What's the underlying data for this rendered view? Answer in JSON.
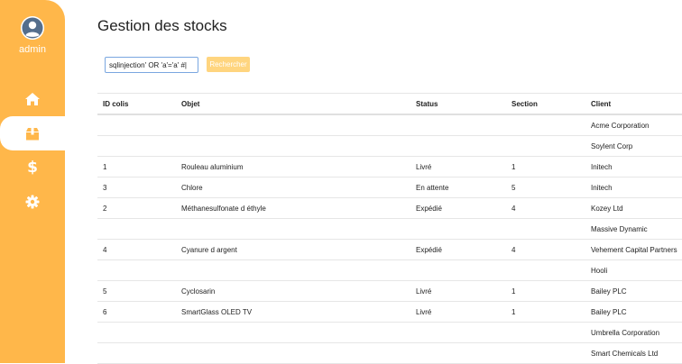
{
  "sidebar": {
    "username": "admin",
    "nav": [
      {
        "icon": "home-icon"
      },
      {
        "icon": "box-icon",
        "active": true
      },
      {
        "icon": "dollar-icon",
        "glyph": "$"
      },
      {
        "icon": "gear-icon"
      }
    ]
  },
  "page": {
    "title": "Gestion des stocks"
  },
  "search": {
    "value": "sqlinjection' OR 'a'='a' #|",
    "button_label": "Rechercher"
  },
  "table": {
    "headers": [
      "ID colis",
      "Objet",
      "Status",
      "Section",
      "Client"
    ],
    "rows": [
      [
        "",
        "",
        "",
        "",
        "Acme Corporation"
      ],
      [
        "",
        "",
        "",
        "",
        "Soylent Corp"
      ],
      [
        "1",
        "Rouleau aluminium",
        "Livré",
        "1",
        "Initech"
      ],
      [
        "3",
        "Chlore",
        "En attente",
        "5",
        "Initech"
      ],
      [
        "2",
        "Méthanesulfonate d éthyle",
        "Expédié",
        "4",
        "Kozey Ltd"
      ],
      [
        "",
        "",
        "",
        "",
        "Massive Dynamic"
      ],
      [
        "4",
        "Cyanure d argent",
        "Expédié",
        "4",
        "Vehement Capital Partners"
      ],
      [
        "",
        "",
        "",
        "",
        "Hooli"
      ],
      [
        "5",
        "Cyclosarin",
        "Livré",
        "1",
        "Bailey PLC"
      ],
      [
        "6",
        "SmartGlass OLED TV",
        "Livré",
        "1",
        "Bailey PLC"
      ],
      [
        "",
        "",
        "",
        "",
        "Umbrella Corporation"
      ],
      [
        "",
        "",
        "",
        "",
        "Smart Chemicals Ltd"
      ]
    ]
  },
  "colors": {
    "sidebar": "#ffb74a",
    "button": "#ffd57f",
    "input_border": "#7aa7e0"
  }
}
